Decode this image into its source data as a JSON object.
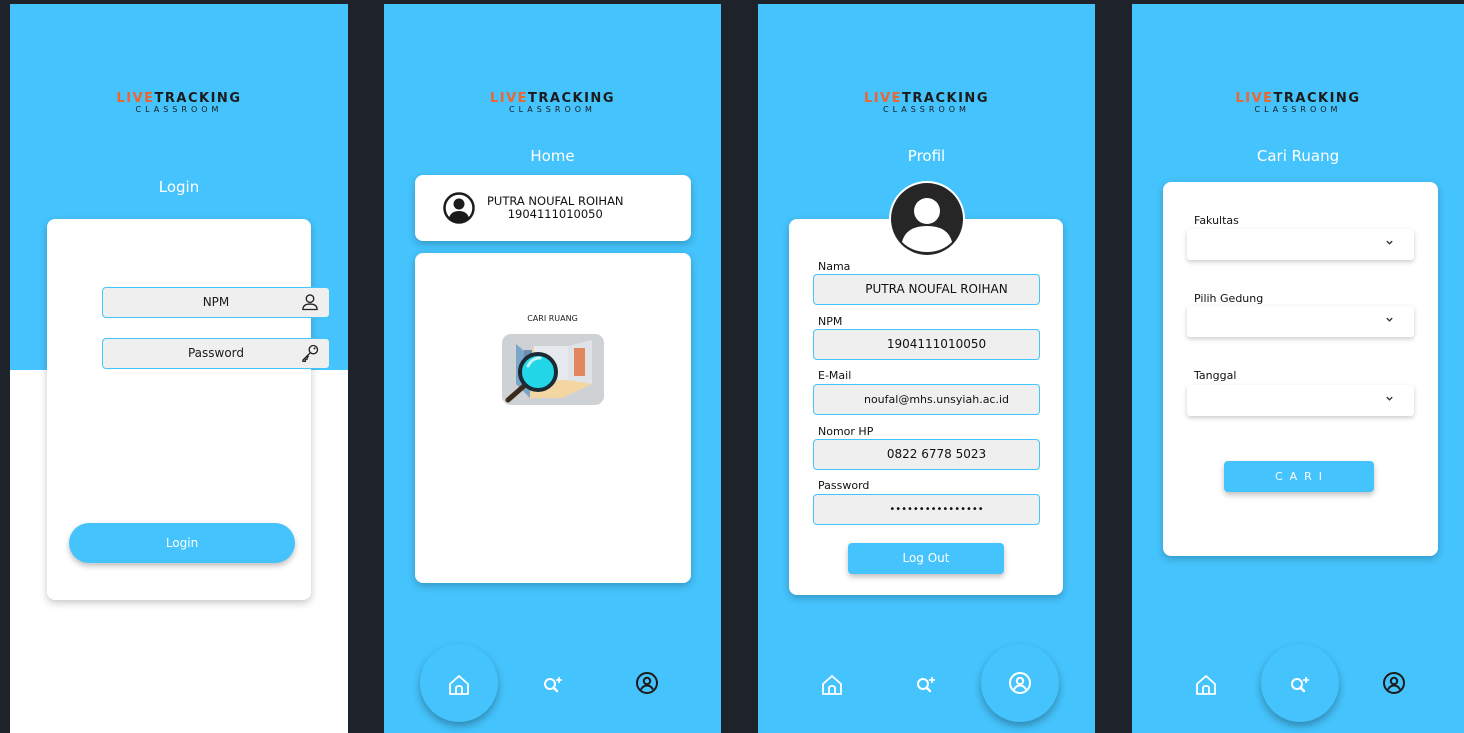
{
  "app": {
    "logo_main_1": "LIVE",
    "logo_main_2": "TRACKING",
    "logo_sub": "CLASSROOM",
    "colors": {
      "primary": "#45c3fc",
      "accent": "#f0642d",
      "background": "#1e232b"
    }
  },
  "login": {
    "title": "Login",
    "npm_placeholder": "NPM",
    "password_placeholder": "Password",
    "login_button": "Login",
    "icons": {
      "npm": "user-icon",
      "password": "key-icon"
    }
  },
  "home": {
    "title": "Home",
    "user_name": "PUTRA NOUFAL ROIHAN",
    "user_npm": "1904111010050",
    "cari_ruang_label": "CARI RUANG",
    "icons": {
      "user": "user-circle-icon",
      "cari": "room-search-icon"
    }
  },
  "profil": {
    "title": "Profil",
    "fields": [
      {
        "label": "Nama",
        "value": "PUTRA NOUFAL ROIHAN"
      },
      {
        "label": "NPM",
        "value": "1904111010050"
      },
      {
        "label": "E-Mail",
        "value": "noufal@mhs.unsyiah.ac.id"
      },
      {
        "label": "Nomor HP",
        "value": "0822 6778 5023"
      },
      {
        "label": "Password",
        "value": "••••••••••••••••"
      }
    ],
    "logout_button": "Log Out"
  },
  "cari_ruang": {
    "title": "Cari Ruang",
    "fields": [
      {
        "label": "Fakultas",
        "value": ""
      },
      {
        "label": "Pilih Gedung",
        "value": ""
      },
      {
        "label": "Tanggal",
        "value": ""
      }
    ],
    "cari_button": "CARI"
  },
  "bottom_nav": {
    "items": [
      "home-icon",
      "search-plus-icon",
      "profile-icon"
    ],
    "active": {
      "home": "home-icon",
      "profil": "profile-icon",
      "cari_ruang": "search-plus-icon"
    }
  }
}
